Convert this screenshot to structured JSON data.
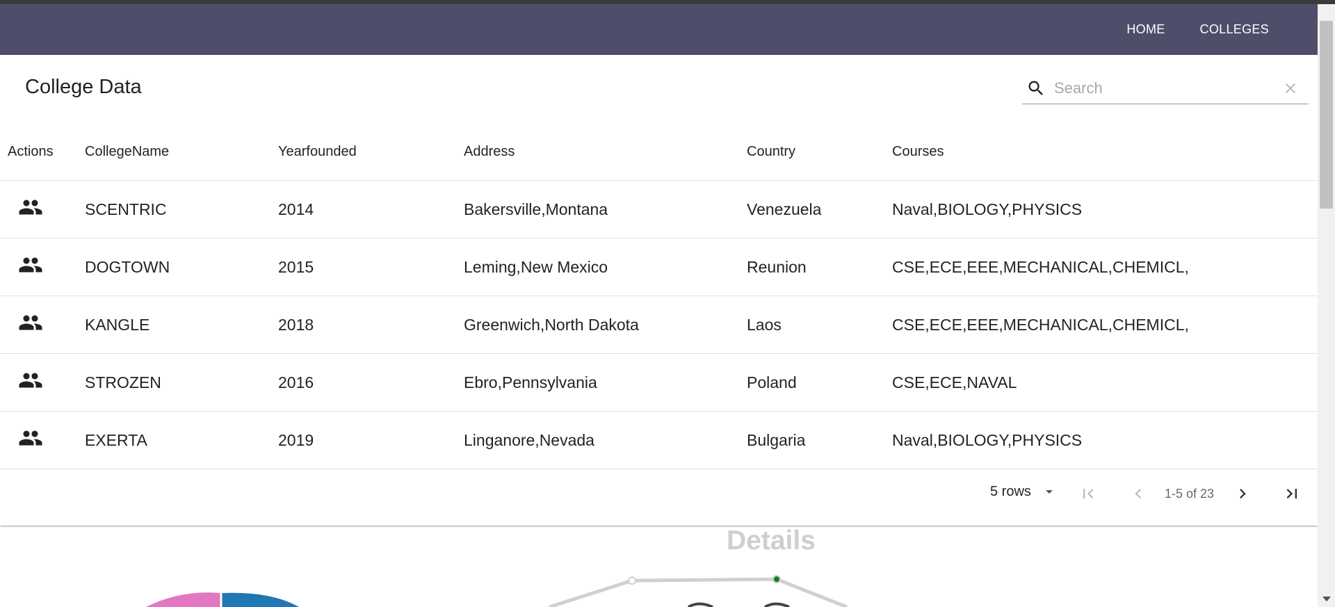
{
  "nav": {
    "home": "HOME",
    "colleges": "COLLEGES"
  },
  "table": {
    "title": "College Data",
    "search_placeholder": "Search",
    "columns": [
      "Actions",
      "CollegeName",
      "Yearfounded",
      "Address",
      "Country",
      "Courses"
    ],
    "rows": [
      {
        "name": "SCENTRIC",
        "year": "2014",
        "address": "Bakersville,Montana",
        "country": "Venezuela",
        "courses": "Naval,BIOLOGY,PHYSICS"
      },
      {
        "name": "DOGTOWN",
        "year": "2015",
        "address": "Leming,New Mexico",
        "country": "Reunion",
        "courses": "CSE,ECE,EEE,MECHANICAL,CHEMICL,"
      },
      {
        "name": "KANGLE",
        "year": "2018",
        "address": "Greenwich,North Dakota",
        "country": "Laos",
        "courses": "CSE,ECE,EEE,MECHANICAL,CHEMICL,"
      },
      {
        "name": "STROZEN",
        "year": "2016",
        "address": "Ebro,Pennsylvania",
        "country": "Poland",
        "courses": "CSE,ECE,NAVAL"
      },
      {
        "name": "EXERTA",
        "year": "2019",
        "address": "Linganore,Nevada",
        "country": "Bulgaria",
        "courses": "Naval,BIOLOGY,PHYSICS"
      }
    ],
    "action_icon": "people-icon"
  },
  "pagination": {
    "rows_per_page": "5 rows",
    "range": "1-5 of 23"
  },
  "chart": {
    "title": "Details"
  },
  "colors": {
    "appbar": "#4e4e6a",
    "pie_pink": "#e377c2",
    "pie_blue": "#1f77b4",
    "line_gray": "#d0d0d0",
    "point_green": "#1a7f1a"
  }
}
